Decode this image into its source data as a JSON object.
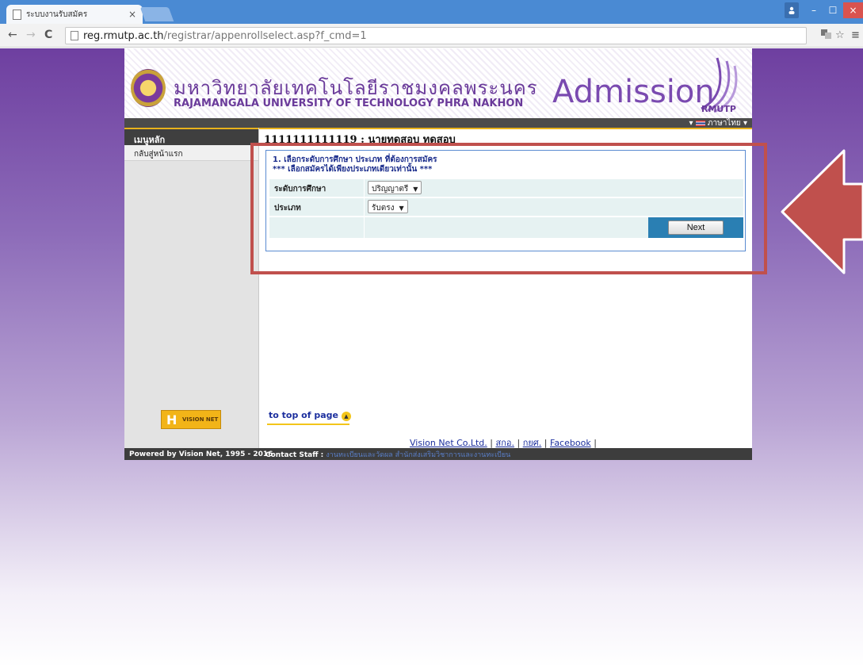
{
  "browser": {
    "tab_title": "ระบบงานรับสมัคร",
    "tab_close": "×",
    "url_host": "reg.rmutp.ac.th",
    "url_path": "/registrar/appenrollselect.asp?f_cmd=1",
    "nav_back": "←",
    "nav_forward": "→",
    "nav_reload": "C",
    "window_min": "–",
    "window_max": "☐",
    "window_close": "×"
  },
  "banner": {
    "name_th": "มหาวิทยาลัยเทคโนโลยีราชมงคลพระนคร",
    "name_en": "RAJAMANGALA UNIVERSITY OF TECHNOLOGY PHRA NAKHON",
    "admission_word": "Admission",
    "admission_sub": "RMUTP",
    "language_label": "ภาษาไทย"
  },
  "sidebar": {
    "header": "เมนูหลัก",
    "items": [
      {
        "label": "กลับสู่หน้าแรก"
      }
    ]
  },
  "content": {
    "header": "1111111111119 : นายทดสอบ ทดสอบ",
    "instruction_line1": "1. เลือกระดับการศึกษา ประเภท ที่ต้องการสมัคร",
    "instruction_line2": "*** เลือกสมัครได้เพียงประเภทเดียวเท่านั้น ***",
    "fields": [
      {
        "label": "ระดับการศึกษา",
        "value": "ปริญญาตรี"
      },
      {
        "label": "ประเภท",
        "value": "รับตรง"
      }
    ],
    "next_label": "Next",
    "to_top_label": "to top of page",
    "footer_links": [
      "Vision Net Co.Ltd.",
      "สกอ.",
      "กยศ.",
      "Facebook"
    ],
    "separator": "|"
  },
  "footer": {
    "powered": "Powered by Vision Net, 1995 - 2016",
    "contact_label": "Contact Staff :",
    "contact_value": "งานทะเบียนและวัดผล สำนักส่งเสริมวิชาการและงานทะเบียน"
  },
  "colors": {
    "annotation": "#c0504d",
    "brand_purple": "#6a3a9a",
    "accent_yellow": "#e9b21c",
    "button_panel": "#2a7fb3"
  }
}
